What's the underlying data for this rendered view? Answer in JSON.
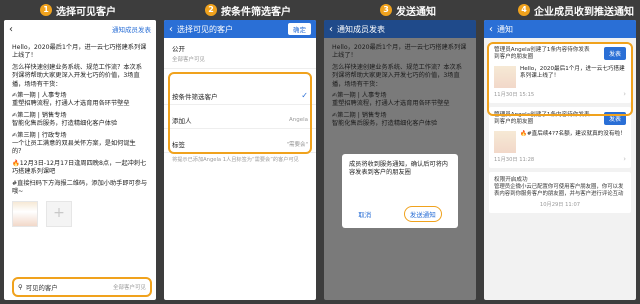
{
  "steps": [
    {
      "num": "1",
      "title": "选择可见客户"
    },
    {
      "num": "2",
      "title": "按条件筛选客户"
    },
    {
      "num": "3",
      "title": "发送通知"
    },
    {
      "num": "4",
      "title": "企业成员收到推送通知"
    }
  ],
  "panel1": {
    "top_link": "通知成员发表",
    "message": [
      "Hello，2020最后1个月，进一云七巧搭建系列课上线了！",
      "怎么样快速创建业务系统、规范工作流？本次系列课将帮助大家更深入开发七巧的价值，3场直播，场场有干货：",
      "✍第一期 | 人事专场\n重塑招聘流程，打通人才选育用各环节壁垒",
      "✍第二期 | 销售专场\n智能化售后服务，打造精细化客户体验",
      "✍第三期 | 行政专场\n一个让员工满意的双县关怀方案，是如何诞生的？",
      "🔥12月3日-12月17日逢周四晚8点，一起冲刺七巧搭建系列课吧",
      "#直接扫码下方海报二维码，添加小助手即可参与哦~"
    ],
    "add_symbol": "+",
    "visible_label": "可见的客户",
    "visible_value": "全部客户可见"
  },
  "panel2": {
    "title": "选择可见的客户",
    "confirm": "确定",
    "opt_public": "公开",
    "opt_public_sub": "全部客户可见",
    "opt_filter": "按条件筛选客户",
    "check": "✓",
    "adder_label": "添加人",
    "adder_value": "Angela",
    "tag_label": "标签",
    "tag_value": "\"需要会\"",
    "tip": "将提示已添加Angela 1人且标签为“需要会”的客户可见"
  },
  "panel3": {
    "title": "通知成员发表",
    "dialog_text": "成员将收到服务通知，确认后可将内容发表到客户的朋友圈",
    "cancel": "取消",
    "send": "发送通知"
  },
  "panel4": {
    "title": "通知",
    "card1_title": "管理员Angela创建了1条内容待你发表到客户的朋友圈",
    "card1_send": "发表",
    "card1_preview": "Hello，2020最后1个月，进一云七巧搭建系列课上线了！",
    "card1_time": "11月30日 15:15",
    "card2_title": "管理员Angela创建了1条内容待你发表到客户的朋友圈",
    "card2_send": "发表",
    "card2_preview": "🔥#直后续4?7名额，建议就真的没有啦！",
    "card2_time": "11月30日 11:28",
    "card3_title": "权限开启成功",
    "card3_desc": "管理员企微小云已配置你可使用客户朋友圈，你可以发表内容到你服务客户的朋友圈，并与客户进行评论互动",
    "card3_time": "10月29日 11:07"
  }
}
